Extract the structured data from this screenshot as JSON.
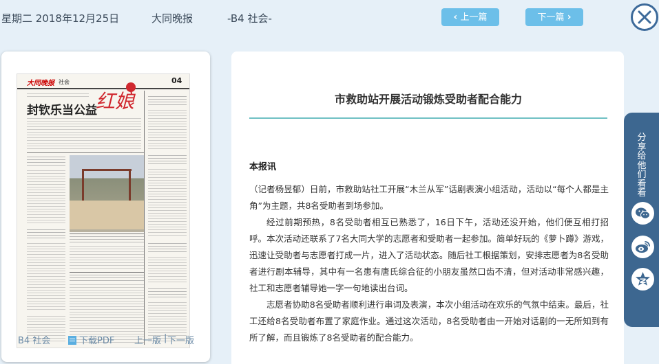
{
  "header": {
    "date": "星期二 2018年12月25日",
    "paper": "大同晚报",
    "section": "-B4 社会-",
    "prev_label": "上一篇",
    "next_label": "下一篇"
  },
  "thumbnail": {
    "masthead": "大同晚报",
    "section": "社会",
    "page_number": "04",
    "headline": "封钦乐当公益",
    "stamp": "红娘"
  },
  "left_footer": {
    "page_label": "B4 社会",
    "download_label": "下载PDF",
    "prev_page_label": "上一版",
    "separator": "|",
    "next_page_label": "下一版"
  },
  "article": {
    "title": "市救助站开展活动锻炼受助者配合能力",
    "byline": "本报讯",
    "paragraphs": [
      "（记者杨昱郁）日前，市救助站社工开展“木兰从军”话剧表演小组活动，活动以“每个人都是主角”为主题，共8名受助者到场参加。",
      "经过前期预热，8名受助者相互已熟悉了，16日下午，活动还没开始，他们便互相打招呼。本次活动还联系了7名大同大学的志愿者和受助者一起参加。简单好玩的《萝卜蹲》游戏，迅速让受助者与志愿者打成一片，进入了活动状态。随后社工根据策划，安排志愿者为8名受助者进行剧本辅导，其中有一名患有唐氏综合征的小朋友虽然口齿不清，但对活动非常感兴趣，社工和志愿者辅导她一字一句地读出台词。",
      "志愿者协助8名受助者顺利进行串词及表演，本次小组活动在欢乐的气氛中结束。最后，社工还给8名受助者布置了家庭作业。通过这次活动，8名受助者由一开始对话剧的一无所知到有所了解，而且锻炼了8名受助者的配合能力。"
    ]
  },
  "share": {
    "label": "分享给他们看看",
    "icons": [
      "wechat-icon",
      "weibo-icon",
      "qzone-star-icon"
    ]
  },
  "colors": {
    "nav_button": "#6cbfe9",
    "share_bar": "#3d6790",
    "title_rule": "#6fc0c4",
    "background": "#e6f0f8"
  }
}
